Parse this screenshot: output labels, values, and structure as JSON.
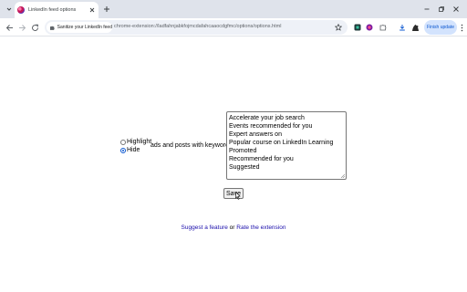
{
  "browser": {
    "tab": {
      "title": "LinkedIn feed options"
    },
    "address_bar": {
      "site_chip": "Sanitize your LinkedIn feed",
      "url": "chrome-extension://ladfahnjabkfojmcdafahcaaocdgfmc/options/options.html"
    },
    "finish_update_label": "Finish update",
    "colors": {
      "tabbar": "#dfe3eb",
      "accent": "#0b57d0"
    }
  },
  "options": {
    "mode_options": [
      "Highlight",
      "Hide"
    ],
    "selected_mode": "Hide",
    "sentence_suffix": "ads and posts with keywords",
    "keywords": [
      "Accelerate your job search",
      "Events recommended for you",
      "Expert answers on",
      "Popular course on LinkedIn Learning",
      "Promoted",
      "Recommended for you",
      "Suggested"
    ],
    "save_label": "Save"
  },
  "footer": {
    "suggest_label": "Suggest a feature",
    "separator": "or",
    "rate_label": "Rate the extension"
  }
}
